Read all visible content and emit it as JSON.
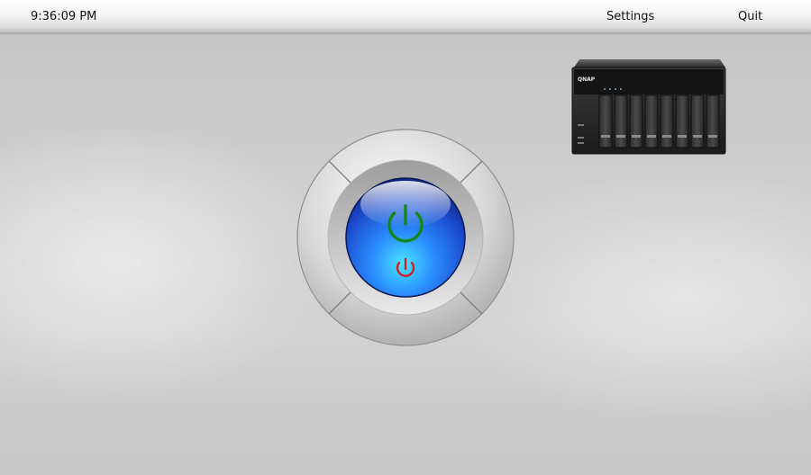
{
  "topbar": {
    "clock": "9:36:09 PM",
    "settings_label": "Settings",
    "quit_label": "Quit"
  },
  "nas_device": {
    "brand": "QNAP",
    "drive_bays": 8
  },
  "power_widget": {
    "buttons": [
      {
        "name": "power-on",
        "icon": "power-icon",
        "color": "#1a8a1a"
      },
      {
        "name": "power-off",
        "icon": "power-icon",
        "color": "#cc1f1f"
      }
    ],
    "knob_color": "#1d5fd6"
  }
}
